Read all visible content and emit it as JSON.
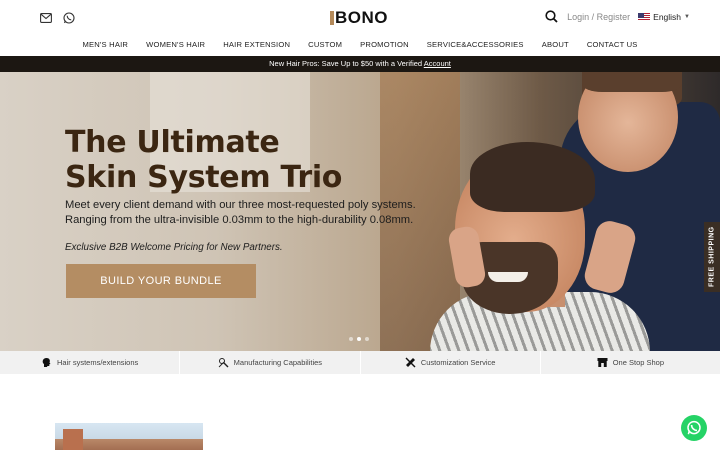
{
  "header": {
    "logo_text": "BONO",
    "login_label": "Login / Register",
    "language": "English",
    "icons": [
      "mail-icon",
      "whatsapp-icon",
      "search-icon",
      "us-flag-icon"
    ]
  },
  "nav": {
    "items": [
      {
        "label": "MEN'S HAIR"
      },
      {
        "label": "WOMEN'S HAIR"
      },
      {
        "label": "HAIR EXTENSION"
      },
      {
        "label": "CUSTOM"
      },
      {
        "label": "PROMOTION"
      },
      {
        "label": "SERVICE&ACCESSORIES"
      },
      {
        "label": "ABOUT"
      },
      {
        "label": "CONTACT US"
      }
    ]
  },
  "promo": {
    "text": "New Hair Pros: Save Up to $50 with a Verified ",
    "link": "Account"
  },
  "hero": {
    "title_line1": "The Ultimate",
    "title_line2": "Skin System Trio",
    "subtitle_line1": "Meet every client demand with our three most-requested poly systems.",
    "subtitle_line2": "Ranging from the ultra-invisible 0.03mm to the high-durability 0.08mm.",
    "note": "Exclusive B2B Welcome Pricing for New Partners.",
    "cta_label": "BUILD YOUR BUNDLE",
    "slide_count": 3,
    "active_slide": 2
  },
  "side_tab": {
    "label": "FREE SHIPPING"
  },
  "features": [
    {
      "label": "Hair systems/extensions",
      "icon": "head-profile-icon"
    },
    {
      "label": "Manufacturing Capabilities",
      "icon": "tools-icon"
    },
    {
      "label": "Customization Service",
      "icon": "ruler-pencil-icon"
    },
    {
      "label": "One Stop Shop",
      "icon": "store-icon"
    }
  ],
  "colors": {
    "accent": "#b48d63",
    "promo_bg": "#1c1712",
    "title": "#3b2612",
    "whatsapp": "#25d366"
  }
}
